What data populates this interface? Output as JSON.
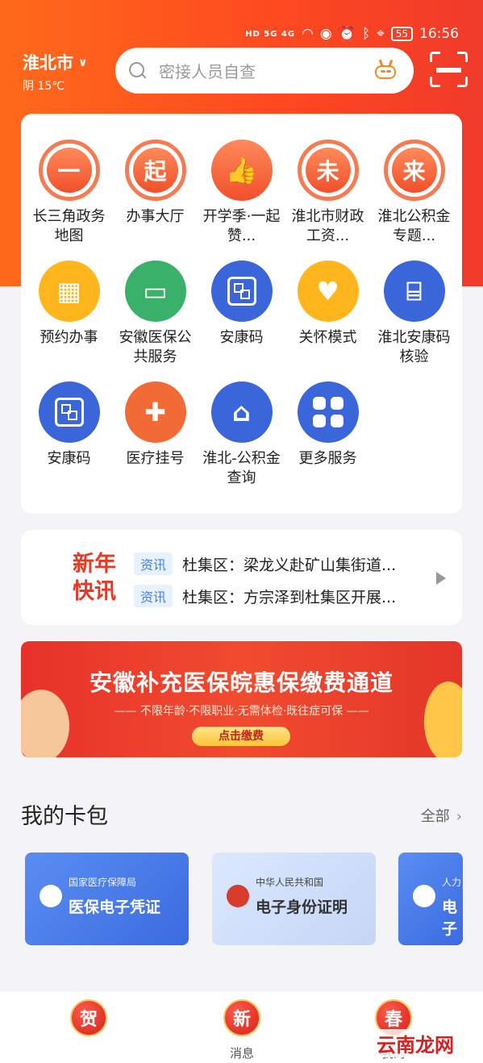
{
  "status_bar": {
    "signal": "HD 5G 4G",
    "battery": "55",
    "time": "16:56"
  },
  "header": {
    "city": "淮北市",
    "weather": "阴 15℃",
    "search_placeholder": "密接人员自查"
  },
  "services": [
    {
      "label": "长三角政务地图",
      "icon_text": "一",
      "icon": "ring-icon"
    },
    {
      "label": "办事大厅",
      "icon_text": "起",
      "icon": "ring-icon"
    },
    {
      "label": "开学季·一起赞...",
      "icon_text": "👍",
      "icon": "thumb-icon"
    },
    {
      "label": "淮北市财政工资...",
      "icon_text": "未",
      "icon": "ring-icon"
    },
    {
      "label": "淮北公积金专题...",
      "icon_text": "来",
      "icon": "ring-icon"
    },
    {
      "label": "预约办事",
      "icon": "calendar-icon"
    },
    {
      "label": "安徽医保公共服务",
      "icon": "card-icon"
    },
    {
      "label": "安康码",
      "icon": "qr-icon"
    },
    {
      "label": "关怀模式",
      "icon": "heart-hand-icon"
    },
    {
      "label": "淮北安康码核验",
      "icon": "scan-icon"
    },
    {
      "label": "安康码",
      "icon": "qr-icon"
    },
    {
      "label": "医疗挂号",
      "icon": "medical-cross-icon"
    },
    {
      "label": "淮北-公积金查询",
      "icon": "house-yuan-icon"
    },
    {
      "label": "更多服务",
      "icon": "grid-icon"
    }
  ],
  "news": {
    "logo_line1": "新年",
    "logo_line2": "快讯",
    "items": [
      {
        "tag": "资讯",
        "text": "杜集区：梁龙义赴矿山集街道..."
      },
      {
        "tag": "资讯",
        "text": "杜集区：方宗泽到杜集区开展..."
      }
    ]
  },
  "banner": {
    "title": "安徽补充医保皖惠保缴费通道",
    "subtitle": "—— 不限年龄·不限职业·无需体检·既往症可保 ——",
    "button": "点击缴费"
  },
  "wallet": {
    "title": "我的卡包",
    "more": "全部",
    "cards": [
      {
        "org": "国家医疗保障局",
        "name": "医保电子凭证"
      },
      {
        "org": "中华人民共和国",
        "name": "电子身份证明"
      },
      {
        "org": "人力",
        "name": "电子"
      }
    ]
  },
  "tabbar": [
    {
      "seal": "贺",
      "label": ""
    },
    {
      "seal": "新",
      "label": "消息"
    },
    {
      "seal": "春",
      "label": "我的"
    }
  ],
  "watermark": "云南龙网"
}
